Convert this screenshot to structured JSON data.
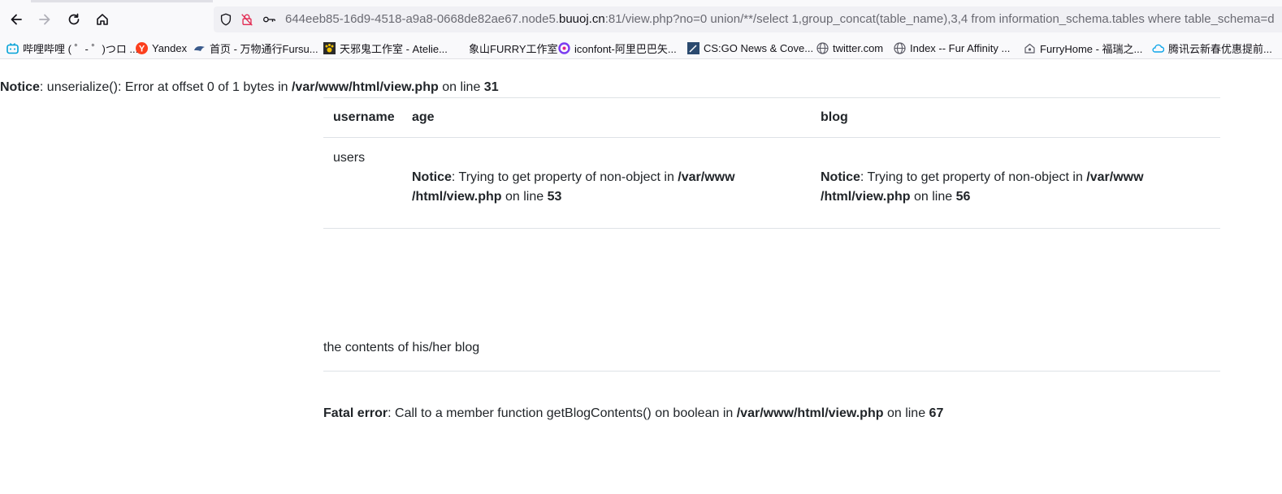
{
  "browser": {
    "url_prefix": "644eeb85-16d9-4518-a9a8-0668de82ae67.node5.",
    "url_host": "buuoj.cn",
    "url_suffix": ":81/view.php?no=0 union/**/select 1,group_concat(table_name),3,4 from information_schema.tables where table_schema=d",
    "bookmarks": [
      {
        "label": "哔哩哔哩 ( ゜- ゜)つロ ...",
        "icon": "bilibili-icon",
        "color": "#00a1d6"
      },
      {
        "label": "Yandex",
        "icon": "yandex-icon",
        "color": "#fc3f1d"
      },
      {
        "label": "首页 - 万物通行Fursu...",
        "icon": "fursuit-icon",
        "color": "#3b5b8c"
      },
      {
        "label": "天邪鬼工作室 - Atelie...",
        "icon": "paw-icon",
        "color": "#c9a400"
      },
      {
        "label": "象山FURRY工作室",
        "icon": "blank-icon",
        "color": "#cccccc"
      },
      {
        "label": "iconfont-阿里巴巴矢...",
        "icon": "iconfont-icon",
        "color": "#7b3cf0"
      },
      {
        "label": "CS:GO News & Cove...",
        "icon": "csgo-icon",
        "color": "#2b4a6f"
      },
      {
        "label": "twitter.com",
        "icon": "globe-icon",
        "color": "#5b5b66"
      },
      {
        "label": "Index -- Fur Affinity ...",
        "icon": "globe-icon",
        "color": "#5b5b66"
      },
      {
        "label": "FurryHome - 福瑞之...",
        "icon": "home-outline-icon",
        "color": "#5b5b66"
      },
      {
        "label": "腾讯云新春优惠提前...",
        "icon": "cloud-icon",
        "color": "#0ea5e9"
      }
    ]
  },
  "page": {
    "top_notice": {
      "label": "Notice",
      "message": ": unserialize(): Error at offset 0 of 1 bytes in ",
      "file": "/var/www/html/view.php",
      "on_line": " on line ",
      "line": "31"
    },
    "table": {
      "headers": [
        "username",
        "age",
        "blog"
      ],
      "username_value": "users",
      "age_notice": {
        "label": "Notice",
        "message": ": Trying to get property of non-object in ",
        "file_part1": "/var/www",
        "file_part2": "/html/view.php",
        "on_line": " on line ",
        "line": "53"
      },
      "blog_notice": {
        "label": "Notice",
        "message": ": Trying to get property of non-object in ",
        "file_part1": "/var/www",
        "file_part2": "/html/view.php",
        "on_line": " on line ",
        "line": "56"
      }
    },
    "blog_text": "the contents of his/her blog",
    "fatal": {
      "label": "Fatal error",
      "message": ": Call to a member function getBlogContents() on boolean in ",
      "file": "/var/www/html/view.php",
      "on_line": " on line ",
      "line": "67"
    }
  }
}
